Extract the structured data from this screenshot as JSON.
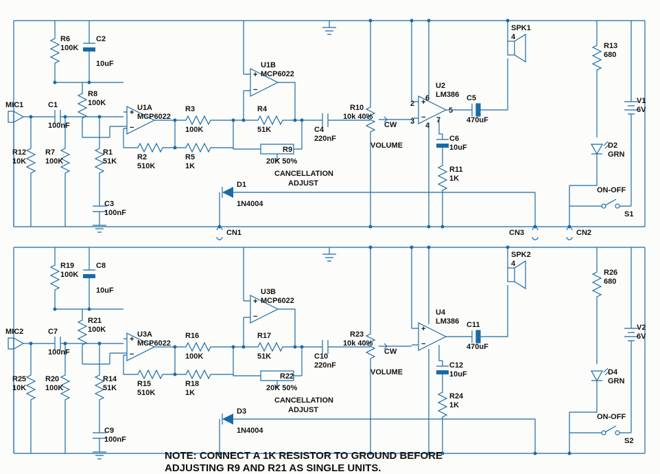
{
  "note_line1": "NOTE: CONNECT A 1K RESISTOR TO GROUND BEFORE",
  "note_line2": "ADJUSTING R9 AND R21 AS SINGLE UNITS.",
  "top": {
    "MIC": {
      "ref": "MIC1"
    },
    "R6": {
      "ref": "R6",
      "val": "100K"
    },
    "C2": {
      "ref": "C2",
      "val": "10uF"
    },
    "R8": {
      "ref": "R8",
      "val": "100K"
    },
    "C1": {
      "ref": "C1",
      "val": "100nF"
    },
    "U1A": {
      "ref": "U1A",
      "val": "MCP6022"
    },
    "U1B": {
      "ref": "U1B",
      "val": "MCP6022"
    },
    "R2": {
      "ref": "R2",
      "val": "510K"
    },
    "R3": {
      "ref": "R3",
      "val": "100K"
    },
    "R4": {
      "ref": "R4",
      "val": "51K"
    },
    "R5": {
      "ref": "R5",
      "val": "1K"
    },
    "R9": {
      "ref": "R9",
      "val": "20K 50%"
    },
    "R9lbl": "CANCELLATION",
    "R9lbl2": "ADJUST",
    "C4": {
      "ref": "C4",
      "val": "220nF"
    },
    "R10": {
      "ref": "R10",
      "val": "10k 40%"
    },
    "R10cw": "CW",
    "R10vol": "VOLUME",
    "U2": {
      "ref": "U2",
      "val": "LM386"
    },
    "C5": {
      "ref": "C5",
      "val": "470uF"
    },
    "C6": {
      "ref": "C6",
      "val": "10uF"
    },
    "R11": {
      "ref": "R11",
      "val": "1K"
    },
    "SPK": {
      "ref": "SPK1",
      "val": "4"
    },
    "R13": {
      "ref": "R13",
      "val": "680"
    },
    "V": {
      "ref": "V1",
      "val": "6V"
    },
    "D2": {
      "ref": "D2",
      "val": "GRN"
    },
    "SW": {
      "ref": "S1",
      "lbl": "ON-OFF"
    },
    "R12": {
      "ref": "R12",
      "val": "10K"
    },
    "R7": {
      "ref": "R7",
      "val": "100K"
    },
    "R1": {
      "ref": "R1",
      "val": "51K"
    },
    "C3": {
      "ref": "C3",
      "val": "100nF"
    },
    "D1": {
      "ref": "D1",
      "val": "1N4004"
    },
    "CN1": "CN1",
    "CN2": "CN2",
    "CN3": "CN3"
  },
  "bot": {
    "MIC": {
      "ref": "MIC2"
    },
    "R19": {
      "ref": "R19",
      "val": "100K"
    },
    "C8": {
      "ref": "C8",
      "val": "10uF"
    },
    "R21": {
      "ref": "R21",
      "val": "100K"
    },
    "C7": {
      "ref": "C7",
      "val": "100nF"
    },
    "U3A": {
      "ref": "U3A",
      "val": "MCP6022"
    },
    "U3B": {
      "ref": "U3B",
      "val": "MCP6022"
    },
    "R15": {
      "ref": "R15",
      "val": "510K"
    },
    "R16": {
      "ref": "R16",
      "val": "100K"
    },
    "R17": {
      "ref": "R17",
      "val": "51K"
    },
    "R18": {
      "ref": "R18",
      "val": "1K"
    },
    "R22": {
      "ref": "R22",
      "val": "20K 50%"
    },
    "R22lbl": "CANCELLATION",
    "R22lbl2": "ADJUST",
    "C10": {
      "ref": "C10",
      "val": "220nF"
    },
    "R23": {
      "ref": "R23",
      "val": "10k 40%"
    },
    "R23cw": "CW",
    "R23vol": "VOLUME",
    "U4": {
      "ref": "U4",
      "val": "LM386"
    },
    "C11": {
      "ref": "C11",
      "val": "470uF"
    },
    "C12": {
      "ref": "C12",
      "val": "10uF"
    },
    "R24": {
      "ref": "R24",
      "val": "1K"
    },
    "SPK": {
      "ref": "SPK2",
      "val": "4"
    },
    "R26": {
      "ref": "R26",
      "val": "680"
    },
    "V": {
      "ref": "V2",
      "val": "6V"
    },
    "D4": {
      "ref": "D4",
      "val": "GRN"
    },
    "SW": {
      "ref": "S2",
      "lbl": "ON-OFF"
    },
    "R25": {
      "ref": "R25",
      "val": "10K"
    },
    "R20": {
      "ref": "R20",
      "val": "100K"
    },
    "R14": {
      "ref": "R14",
      "val": "51K"
    },
    "C9": {
      "ref": "C9",
      "val": "100nF"
    },
    "D3": {
      "ref": "D3",
      "val": "1N4004"
    }
  }
}
